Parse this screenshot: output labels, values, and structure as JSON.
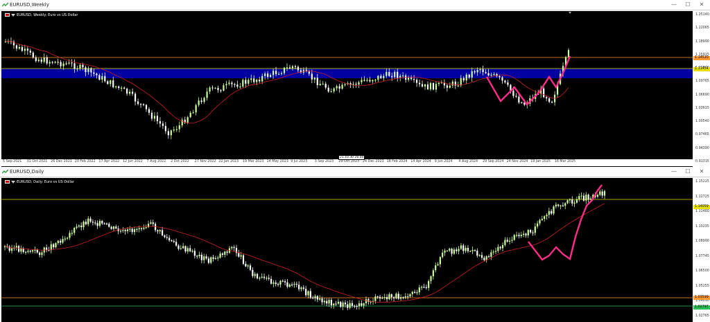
{
  "colors": {
    "background": "#000000",
    "bull_candle": "#ccff99",
    "bear_candle": "#ffffff",
    "moving_average": "#cc2222",
    "wave_line": "#ff2d8a",
    "level_orange": "#ff9933",
    "level_yellow": "#e8e000",
    "level_green": "#2bbf5a",
    "blue_zone": "#0000a0"
  },
  "weekly": {
    "window_title": "EURUSD,Weekly",
    "chart_info": "EURUSD, Weekly: Euro vs US Dollar",
    "price_labels": [
      "1.25140",
      "1.22065",
      "1.18990",
      "1.15915",
      "1.12840",
      "1.09765",
      "1.06690",
      "1.03615",
      "1.00540",
      "0.97465",
      "0.94390",
      "0.91315"
    ],
    "price_tags": [
      "1.14520",
      "1.11454"
    ],
    "date_labels": [
      "5 Sep 2021",
      "31 Oct 2021",
      "26 Dec 2021",
      "20 Feb 2022",
      "17 Apr 2022",
      "12 Jun 2022",
      "7 Aug 2022",
      "2 Oct 2022",
      "27 Nov 2022",
      "22 Jan 2023",
      "19 Mar 2023",
      "14 May 2023",
      "9 Jul 2023",
      "3 Sep 2023",
      "29 Oct 2023",
      "24 Dec 2023",
      "18 Feb 2024",
      "14 Apr 2024",
      "9 Jun 2024",
      "4 Aug 2024",
      "29 Sep 2024",
      "24 Nov 2024",
      "19 Jan 2025",
      "16 Mar 2025"
    ],
    "crosshair_labels": [
      "21.10.30",
      "28.00"
    ]
  },
  "daily": {
    "window_title": "EURUSD,Daily",
    "chart_info": "EURUSD, Daily: Euro vs US Dollar",
    "price_labels": [
      "1.15215",
      "1.12725",
      "1.11480",
      "1.10235",
      "1.08990",
      "1.07745",
      "1.06500",
      "1.05255",
      "1.04010",
      "1.02765"
    ],
    "price_tags": [
      "1.14059",
      "1.03599",
      "1.02797"
    ]
  },
  "window_buttons": {
    "minimize": "—",
    "maximize": "☐",
    "close": "✕"
  }
}
